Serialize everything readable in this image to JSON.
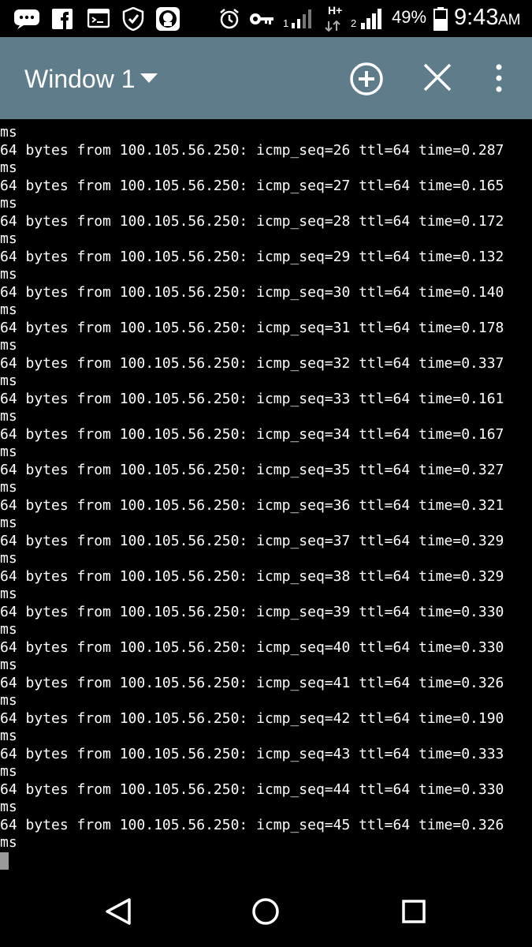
{
  "status_bar": {
    "icons_left": [
      "messages-icon",
      "facebook-icon",
      "terminal-app-icon",
      "vpn-shield-icon",
      "app-badge-icon"
    ],
    "icons_right": [
      "alarm-icon",
      "vpn-key-icon",
      "signal-icon",
      "data-arrows-icon",
      "signal-icon"
    ],
    "network_type": "H+",
    "sim1_label": "1",
    "sim2_label": "2",
    "battery_percent": "49%",
    "time": "9:43",
    "ampm": "AM"
  },
  "action_bar": {
    "title": "Window 1",
    "add_icon": "add-window-icon",
    "close_icon": "close-window-icon",
    "menu_icon": "overflow-menu-icon",
    "background": "#5f7c8b"
  },
  "terminal": {
    "lines": [
      "ms",
      "64 bytes from 100.105.56.250: icmp_seq=26 ttl=64 time=0.287",
      "ms",
      "64 bytes from 100.105.56.250: icmp_seq=27 ttl=64 time=0.165",
      "ms",
      "64 bytes from 100.105.56.250: icmp_seq=28 ttl=64 time=0.172",
      "ms",
      "64 bytes from 100.105.56.250: icmp_seq=29 ttl=64 time=0.132",
      "ms",
      "64 bytes from 100.105.56.250: icmp_seq=30 ttl=64 time=0.140",
      "ms",
      "64 bytes from 100.105.56.250: icmp_seq=31 ttl=64 time=0.178",
      "ms",
      "64 bytes from 100.105.56.250: icmp_seq=32 ttl=64 time=0.337",
      "ms",
      "64 bytes from 100.105.56.250: icmp_seq=33 ttl=64 time=0.161",
      "ms",
      "64 bytes from 100.105.56.250: icmp_seq=34 ttl=64 time=0.167",
      "ms",
      "64 bytes from 100.105.56.250: icmp_seq=35 ttl=64 time=0.327",
      "ms",
      "64 bytes from 100.105.56.250: icmp_seq=36 ttl=64 time=0.321",
      "ms",
      "64 bytes from 100.105.56.250: icmp_seq=37 ttl=64 time=0.329",
      "ms",
      "64 bytes from 100.105.56.250: icmp_seq=38 ttl=64 time=0.329",
      "ms",
      "64 bytes from 100.105.56.250: icmp_seq=39 ttl=64 time=0.330",
      "ms",
      "64 bytes from 100.105.56.250: icmp_seq=40 ttl=64 time=0.330",
      "ms",
      "64 bytes from 100.105.56.250: icmp_seq=41 ttl=64 time=0.326",
      "ms",
      "64 bytes from 100.105.56.250: icmp_seq=42 ttl=64 time=0.190",
      "ms",
      "64 bytes from 100.105.56.250: icmp_seq=43 ttl=64 time=0.333",
      "ms",
      "64 bytes from 100.105.56.250: icmp_seq=44 ttl=64 time=0.330",
      "ms",
      "64 bytes from 100.105.56.250: icmp_seq=45 ttl=64 time=0.326",
      "ms"
    ],
    "text_color": "#ffffff",
    "background": "#000000"
  },
  "nav_bar": {
    "back_icon": "back-triangle-icon",
    "home_icon": "home-circle-icon",
    "recents_icon": "recents-square-icon"
  }
}
